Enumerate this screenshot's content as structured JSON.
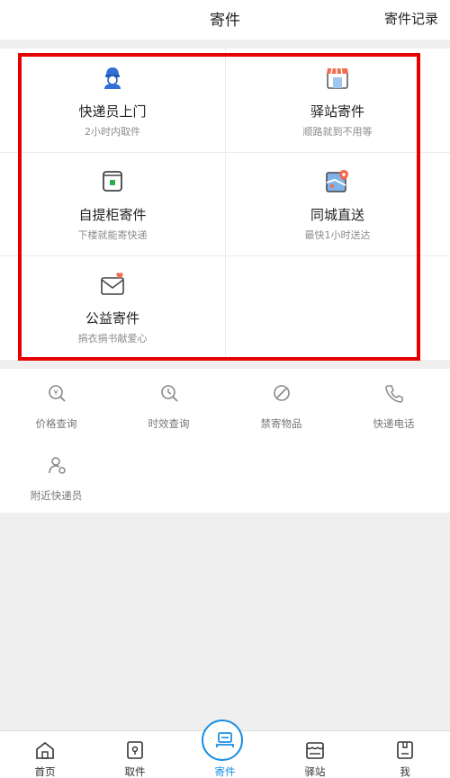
{
  "header": {
    "title": "寄件",
    "record_label": "寄件记录"
  },
  "services": [
    {
      "name": "快递员上门",
      "desc": "2小时内取件",
      "icon": "courier-icon"
    },
    {
      "name": "驿站寄件",
      "desc": "顺路就到不用等",
      "icon": "station-icon"
    },
    {
      "name": "自提柜寄件",
      "desc": "下楼就能寄快递",
      "icon": "locker-icon"
    },
    {
      "name": "同城直送",
      "desc": "最快1小时送达",
      "icon": "map-pin-icon"
    },
    {
      "name": "公益寄件",
      "desc": "捐衣捐书献爱心",
      "icon": "heart-envelope-icon"
    }
  ],
  "tools": [
    {
      "label": "价格查询",
      "icon": "price-search-icon"
    },
    {
      "label": "时效查询",
      "icon": "time-search-icon"
    },
    {
      "label": "禁寄物品",
      "icon": "prohibited-icon"
    },
    {
      "label": "快递电话",
      "icon": "phone-icon"
    },
    {
      "label": "附近快递员",
      "icon": "person-pin-icon"
    }
  ],
  "tabbar": [
    {
      "label": "首页",
      "icon": "home-icon"
    },
    {
      "label": "取件",
      "icon": "pickup-icon"
    },
    {
      "label": "寄件",
      "icon": "send-icon"
    },
    {
      "label": "驿站",
      "icon": "station-tab-icon"
    },
    {
      "label": "我",
      "icon": "me-icon"
    }
  ],
  "colors": {
    "accent": "#1a8fe3",
    "highlight": "#e60000",
    "text": "#222222",
    "subtext": "#8c8c8c"
  }
}
